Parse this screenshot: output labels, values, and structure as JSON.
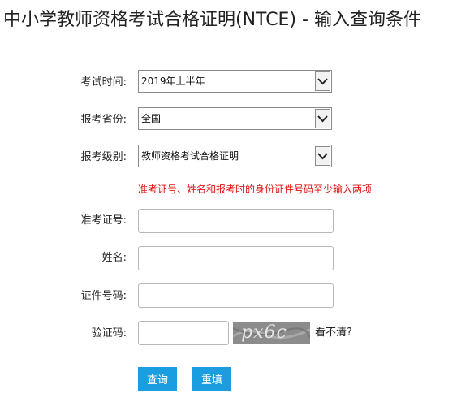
{
  "page": {
    "title": "中小学教师资格考试合格证明(NTCE) - 输入查询条件"
  },
  "form": {
    "exam_time": {
      "label": "考试时间:",
      "value": "2019年上半年"
    },
    "province": {
      "label": "报考省份:",
      "value": "全国"
    },
    "level": {
      "label": "报考级别:",
      "value": "教师资格考试合格证明"
    },
    "hint": "准考证号、姓名和报考时的身份证件号码至少输入两项",
    "ticket_number": {
      "label": "准考证号:",
      "value": ""
    },
    "name": {
      "label": "姓名:",
      "value": ""
    },
    "id_number": {
      "label": "证件号码:",
      "value": ""
    },
    "captcha": {
      "label": "验证码:",
      "value": "",
      "image_text": "px6c",
      "refresh_label": "看不清?"
    }
  },
  "buttons": {
    "query_label": "查询",
    "reset_label": "重填",
    "color": "#1a9ee0"
  },
  "colors": {
    "hint": "#e01010"
  }
}
